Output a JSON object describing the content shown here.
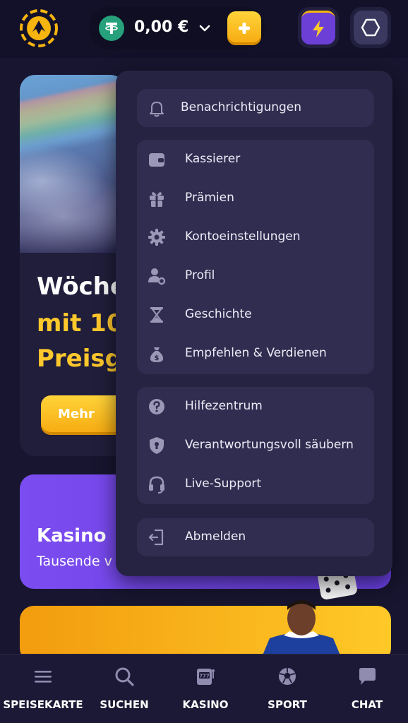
{
  "header": {
    "balance": "0,00 €",
    "currency_icon": "tether-icon",
    "colors": {
      "deposit": "#f6b40f",
      "bolt": "#6c3fd6",
      "tether": "#26a17b"
    }
  },
  "promo": {
    "title_line1": "Wöche",
    "title_line2": "mit 10",
    "title_line3": "Preisg",
    "more_label": "Mehr"
  },
  "casino": {
    "title": "Kasino",
    "subtitle": "Tausende v"
  },
  "menu": {
    "notifications": {
      "label": "Benachrichtigungen",
      "icon": "bell-icon"
    },
    "account_items": [
      {
        "label": "Kassierer",
        "icon": "wallet-icon"
      },
      {
        "label": "Prämien",
        "icon": "gift-icon"
      },
      {
        "label": "Kontoeinstellungen",
        "icon": "gear-icon"
      },
      {
        "label": "Profil",
        "icon": "user-settings-icon"
      },
      {
        "label": "Geschichte",
        "icon": "hourglass-icon"
      },
      {
        "label": "Empfehlen & Verdienen",
        "icon": "money-bag-icon"
      }
    ],
    "support_items": [
      {
        "label": "Hilfezentrum",
        "icon": "question-icon"
      },
      {
        "label": "Verantwortungsvoll säubern",
        "icon": "shield-lock-icon"
      },
      {
        "label": "Live-Support",
        "icon": "headset-icon"
      }
    ],
    "logout": {
      "label": "Abmelden",
      "icon": "logout-icon"
    }
  },
  "bottom_nav": [
    {
      "label": "SPEISEKARTE",
      "icon": "menu-icon"
    },
    {
      "label": "SUCHEN",
      "icon": "search-icon"
    },
    {
      "label": "KASINO",
      "icon": "slot-machine-icon"
    },
    {
      "label": "SPORT",
      "icon": "soccer-ball-icon"
    },
    {
      "label": "CHAT",
      "icon": "chat-icon"
    }
  ]
}
